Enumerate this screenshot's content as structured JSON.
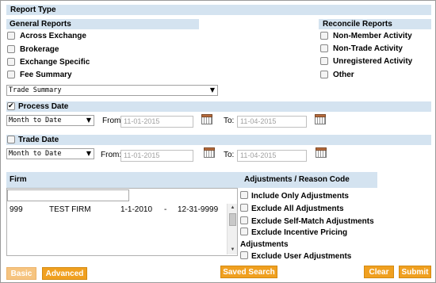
{
  "report_type": {
    "title": "Report Type"
  },
  "general_reports": {
    "title": "General Reports",
    "items": [
      "Across Exchange",
      "Brokerage",
      "Exchange Specific",
      "Fee Summary"
    ],
    "select_value": "Trade Summary"
  },
  "reconcile_reports": {
    "title": "Reconcile Reports",
    "items": [
      "Non-Member Activity",
      "Non-Trade Activity",
      "Unregistered Activity",
      "Other"
    ]
  },
  "process_date": {
    "title": "Process Date",
    "checked": true,
    "period": "Month to Date",
    "from_label": "From",
    "from_value": "11-01-2015",
    "to_label": "To:",
    "to_value": "11-04-2015"
  },
  "trade_date": {
    "title": "Trade Date",
    "checked": false,
    "period": "Month to Date",
    "from_label": "From:",
    "from_value": "11-01-2015",
    "to_label": "To:",
    "to_value": "11-04-2015"
  },
  "firm": {
    "title": "Firm",
    "search_value": "",
    "rows": [
      {
        "id": "999",
        "name": "TEST FIRM",
        "start": "1-1-2010",
        "sep": "-",
        "end": "12-31-9999"
      }
    ]
  },
  "adjustments": {
    "title": "Adjustments / Reason Code",
    "items": [
      "Include Only Adjustments",
      "Exclude All Adjustments",
      "Exclude Self-Match Adjustments",
      "Exclude Incentive Pricing",
      "Adjustments",
      "Exclude User Adjustments"
    ]
  },
  "buttons": {
    "basic": "Basic",
    "advanced": "Advanced",
    "saved_search": "Saved Search",
    "clear": "Clear",
    "submit": "Submit"
  },
  "colors": {
    "section_bar": "#d4e3f0",
    "button_orange": "#f0a020",
    "button_light": "#f6c480"
  }
}
